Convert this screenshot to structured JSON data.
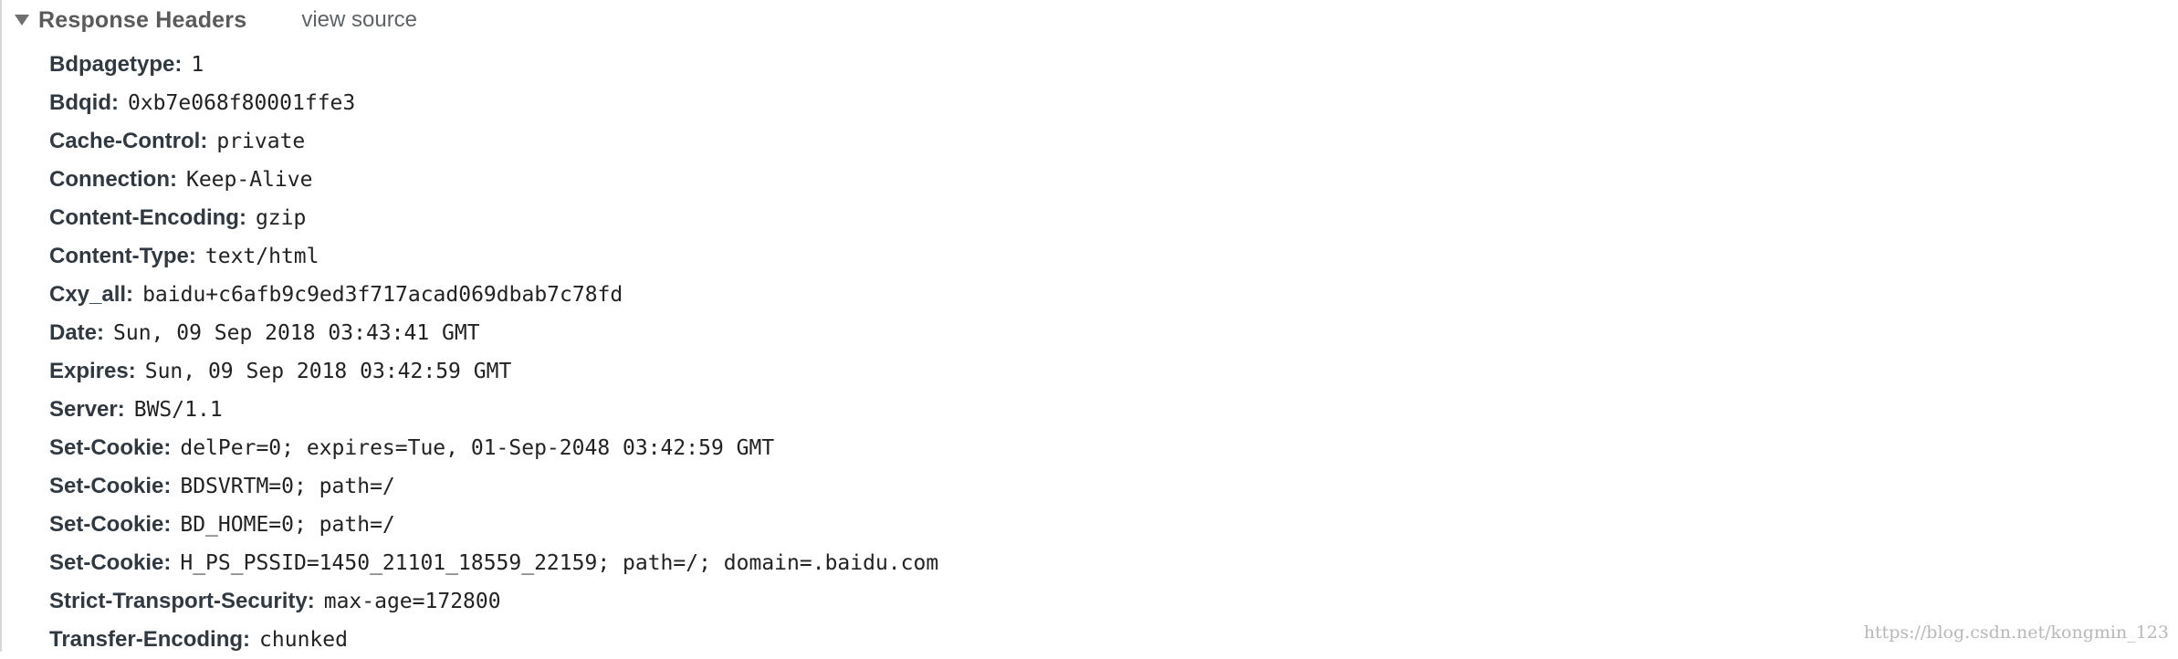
{
  "section": {
    "title": "Response Headers",
    "view_source_label": "view source",
    "expanded_icon": "triangle-down-icon"
  },
  "headers": [
    {
      "name": "Bdpagetype:",
      "value": "1"
    },
    {
      "name": "Bdqid:",
      "value": "0xb7e068f80001ffe3"
    },
    {
      "name": "Cache-Control:",
      "value": "private"
    },
    {
      "name": "Connection:",
      "value": "Keep-Alive"
    },
    {
      "name": "Content-Encoding:",
      "value": "gzip"
    },
    {
      "name": "Content-Type:",
      "value": "text/html"
    },
    {
      "name": "Cxy_all:",
      "value": "baidu+c6afb9c9ed3f717acad069dbab7c78fd"
    },
    {
      "name": "Date:",
      "value": "Sun, 09 Sep 2018 03:43:41 GMT"
    },
    {
      "name": "Expires:",
      "value": "Sun, 09 Sep 2018 03:42:59 GMT"
    },
    {
      "name": "Server:",
      "value": "BWS/1.1"
    },
    {
      "name": "Set-Cookie:",
      "value": "delPer=0; expires=Tue, 01-Sep-2048 03:42:59 GMT"
    },
    {
      "name": "Set-Cookie:",
      "value": "BDSVRTM=0; path=/"
    },
    {
      "name": "Set-Cookie:",
      "value": "BD_HOME=0; path=/"
    },
    {
      "name": "Set-Cookie:",
      "value": "H_PS_PSSID=1450_21101_18559_22159; path=/; domain=.baidu.com"
    },
    {
      "name": "Strict-Transport-Security:",
      "value": "max-age=172800"
    },
    {
      "name": "Transfer-Encoding:",
      "value": "chunked"
    }
  ],
  "watermark": "https://blog.csdn.net/kongmin_123"
}
